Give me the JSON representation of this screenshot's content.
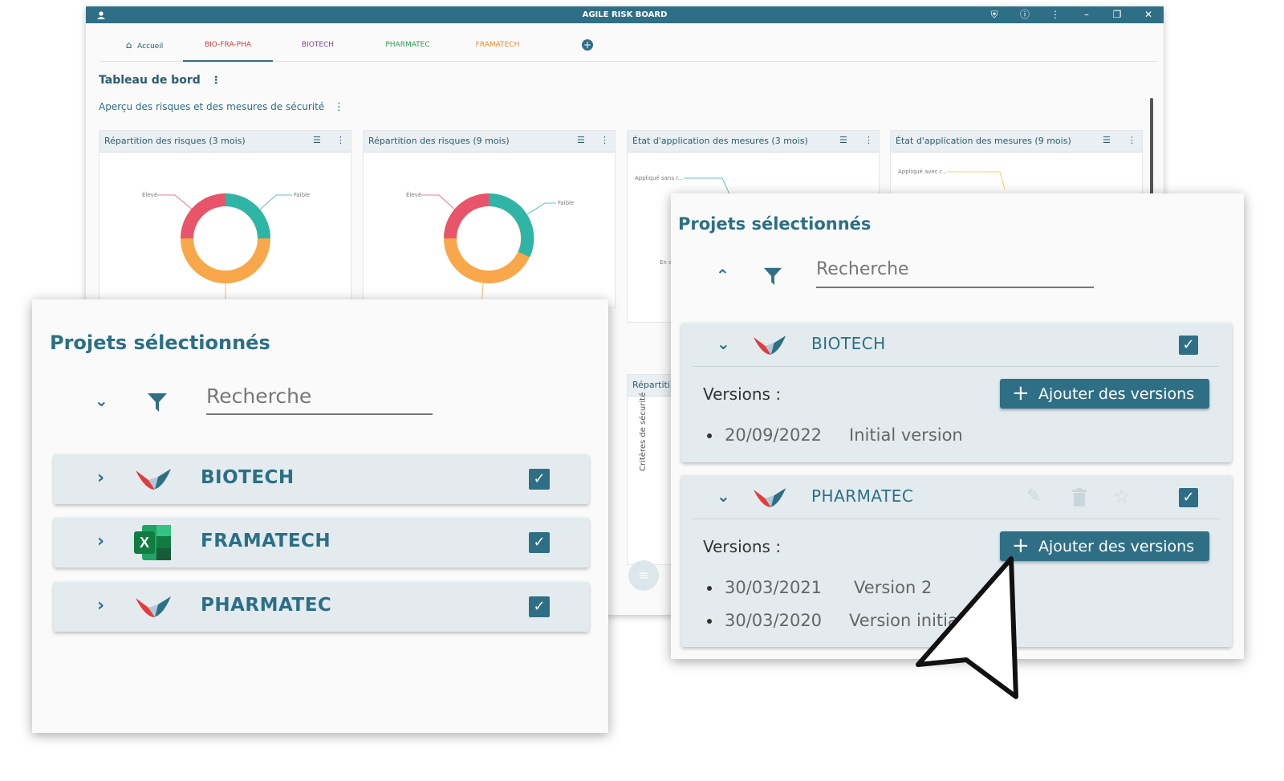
{
  "window": {
    "title": "AGILE RISK BOARD"
  },
  "tabs": [
    {
      "label": "Accueil",
      "color": "#2b5c6e"
    },
    {
      "label": "BIO-FRA-PHA",
      "color": "#d63b3b"
    },
    {
      "label": "BIOTECH",
      "color": "#8a3aa5"
    },
    {
      "label": "PHARMATEC",
      "color": "#2e9b4d"
    },
    {
      "label": "FRAMATECH",
      "color": "#f08a24"
    }
  ],
  "dashboard": {
    "title": "Tableau de bord",
    "subtitle": "Aperçu des risques et des mesures de sécurité",
    "cards": [
      {
        "title": "Répartition des risques (3 mois)",
        "label_left": "Élevé",
        "label_right": "Faible"
      },
      {
        "title": "Répartition des risques (9 mois)",
        "label_left": "Élevé",
        "label_right": "Faible"
      },
      {
        "title": "État d'application des mesures (3 mois)",
        "label_a": "Appliqué sans r...",
        "label_b": "En c"
      },
      {
        "title": "État d'application des mesures (9 mois)",
        "label_a": "Appliqué avec r..."
      }
    ],
    "lower_card_title": "Répartiti",
    "lower_axis_label": "Critères de sécurité"
  },
  "panel_left": {
    "title": "Projets sélectionnés",
    "search_placeholder": "Recherche",
    "projects": [
      {
        "name": "BIOTECH",
        "logo": "bird-logo-icon",
        "checked": true
      },
      {
        "name": "FRAMATECH",
        "logo": "excel-icon",
        "checked": true
      },
      {
        "name": "PHARMATEC",
        "logo": "bird-logo-icon",
        "checked": true
      }
    ]
  },
  "panel_right": {
    "title": "Projets sélectionnés",
    "search_placeholder": "Recherche",
    "projects": [
      {
        "name": "BIOTECH",
        "versions_label": "Versions :",
        "add_label": "Ajouter des versions",
        "versions": [
          {
            "date": "20/09/2022",
            "name": "Initial version"
          }
        ]
      },
      {
        "name": "PHARMATEC",
        "versions_label": "Versions :",
        "add_label": "Ajouter des versions",
        "versions": [
          {
            "date": "30/03/2021",
            "name": "Version 2"
          },
          {
            "date": "30/03/2020",
            "name": "Version initial"
          }
        ]
      }
    ]
  },
  "colors": {
    "primary": "#2f6f86",
    "donut_red": "#e8556a",
    "donut_teal": "#2fb5a5",
    "donut_orange": "#f8a74a"
  }
}
